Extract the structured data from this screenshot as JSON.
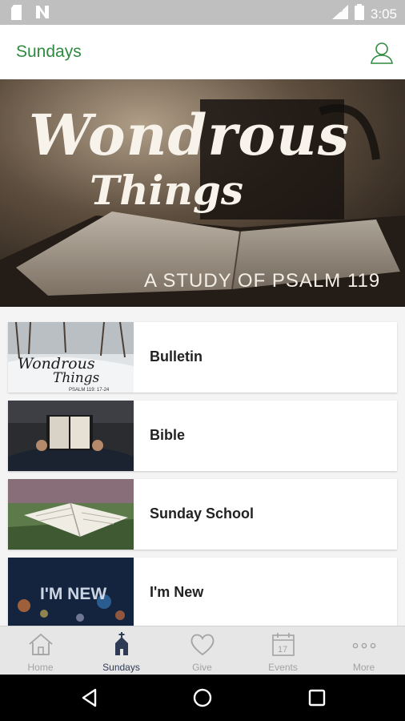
{
  "status_bar": {
    "time": "3:05",
    "icons": [
      "sd-card-icon",
      "notification-n-icon",
      "signal-icon",
      "battery-icon"
    ]
  },
  "app_bar": {
    "title": "Sundays",
    "profile_icon": "person-icon"
  },
  "hero": {
    "title_line1": "Wondrous",
    "title_line2": "Things",
    "subtitle": "A STUDY OF PSALM 119"
  },
  "cards": [
    {
      "label": "Bulletin",
      "thumb_text_1": "Wondrous",
      "thumb_text_2": "Things",
      "thumb_text_3": "PSALM 119: 17-24"
    },
    {
      "label": "Bible"
    },
    {
      "label": "Sunday School"
    },
    {
      "label": "I'm New",
      "thumb_text_1": "I'M NEW"
    }
  ],
  "bottom_nav": {
    "items": [
      {
        "label": "Home",
        "icon": "home-icon"
      },
      {
        "label": "Sundays",
        "icon": "church-icon",
        "active": true
      },
      {
        "label": "Give",
        "icon": "heart-icon"
      },
      {
        "label": "Events",
        "icon": "calendar-icon",
        "calendar_day": "17"
      },
      {
        "label": "More",
        "icon": "more-dots-icon"
      }
    ]
  },
  "colors": {
    "accent_green": "#2e8b3f",
    "active_nav": "#2f3b55",
    "inactive_nav": "#a3a3a3"
  }
}
